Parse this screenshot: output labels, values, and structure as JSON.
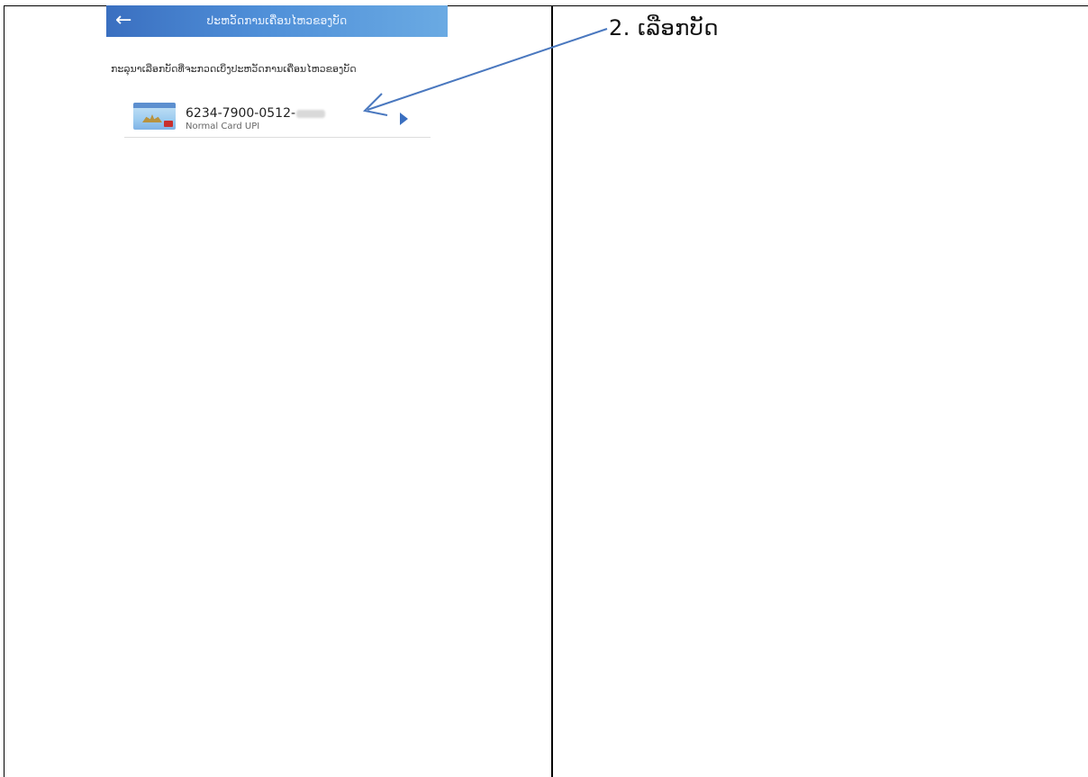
{
  "phone": {
    "title": "ປະຫວັດການເຄື່ອນໄຫວຂອງບັດ",
    "back_icon": "arrow-left-icon",
    "instruction": "ກະລຸນາເລືອກບັດທີ່ຈະກວດເບິ່ງປະຫວັດການເຄື່ອນໄຫວຂອງບັດ",
    "card": {
      "number_prefix": "6234-7900-0512-",
      "type": "Normal Card UPI",
      "chevron_icon": "chevron-right-icon"
    }
  },
  "annotation": {
    "label": "2.  ເລືອກບັດ",
    "arrow_color": "#4a78bf"
  },
  "colors": {
    "topbar_start": "#3a6fc0",
    "topbar_end": "#6aaae3",
    "chevron": "#3a6fc0"
  }
}
